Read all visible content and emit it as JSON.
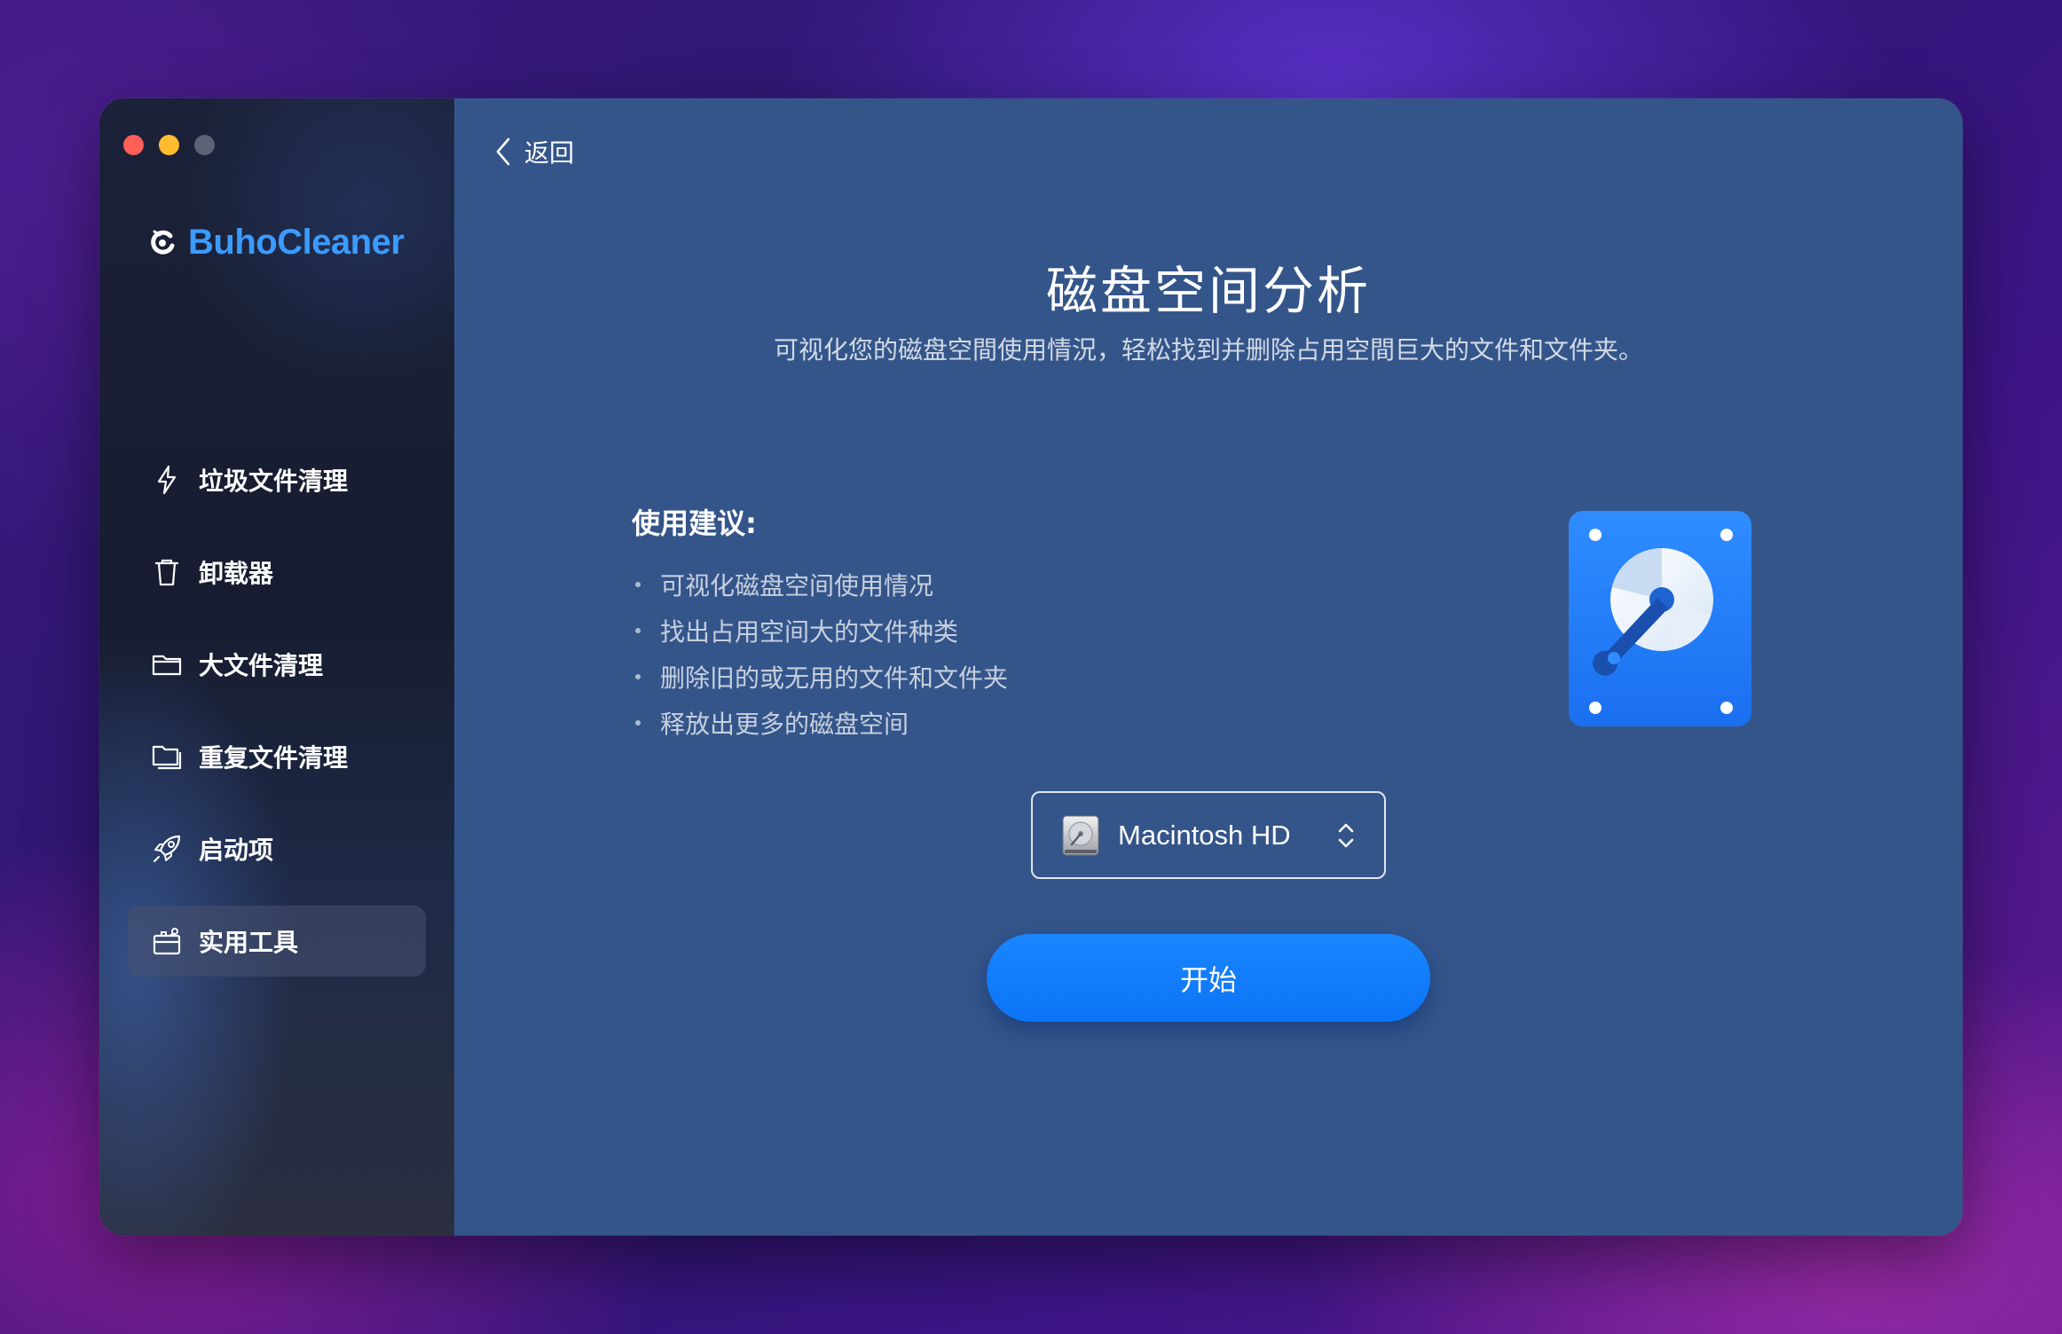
{
  "app": {
    "name": "BuhoCleaner",
    "brand_color": "#3b9bff"
  },
  "window_controls": {
    "close_color": "#fe5f57",
    "minimize_color": "#febc2e",
    "zoom_color": "#5d6275"
  },
  "sidebar": {
    "items": [
      {
        "label": "垃圾文件清理",
        "icon": "lightning-icon",
        "active": false
      },
      {
        "label": "卸载器",
        "icon": "trash-icon",
        "active": false
      },
      {
        "label": "大文件清理",
        "icon": "folder-icon",
        "active": false
      },
      {
        "label": "重复文件清理",
        "icon": "duplicate-folder-icon",
        "active": false
      },
      {
        "label": "启动项",
        "icon": "rocket-icon",
        "active": false
      },
      {
        "label": "实用工具",
        "icon": "toolbox-icon",
        "active": true
      }
    ]
  },
  "main": {
    "back_label": "返回",
    "title": "磁盘空间分析",
    "subtitle": "可视化您的磁盘空間使用情況，轻松找到并删除占用空間巨大的文件和文件夹。",
    "advice": {
      "title": "使用建议:",
      "items": [
        "可视化磁盘空间使用情况",
        "找出占用空间大的文件种类",
        "删除旧的或无用的文件和文件夹",
        "释放出更多的磁盘空间"
      ]
    },
    "volume_select": {
      "selected": "Macintosh HD",
      "icon": "hard-drive-icon"
    },
    "start_label": "开始",
    "accent_color": "#0b74f5"
  }
}
